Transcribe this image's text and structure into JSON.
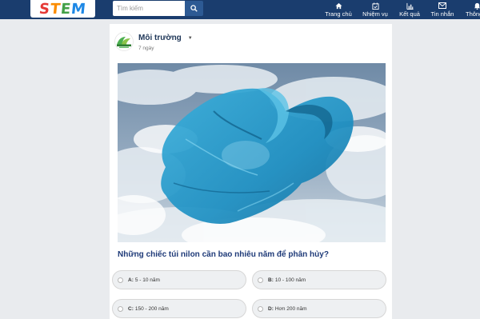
{
  "header": {
    "logo_text": "STEM",
    "search": {
      "placeholder": "Tìm kiếm"
    },
    "nav": [
      {
        "label": "Trang chủ",
        "icon": "home-icon"
      },
      {
        "label": "Nhiệm vụ",
        "icon": "calendar-check-icon"
      },
      {
        "label": "Kết quả",
        "icon": "bar-chart-icon"
      },
      {
        "label": "Tin nhắn",
        "icon": "envelope-icon"
      },
      {
        "label": "Thông",
        "icon": "bell-icon"
      }
    ]
  },
  "post": {
    "author": "Môi trường",
    "time": "7 ngày",
    "question": "Những chiếc túi nilon cần bao nhiêu năm để phân hủy?",
    "options": [
      {
        "key": "A:",
        "text": "5 - 10 năm"
      },
      {
        "key": "B:",
        "text": "10 - 100 năm"
      },
      {
        "key": "C:",
        "text": "150 - 200 năm"
      },
      {
        "key": "D:",
        "text": "Hơn 200 năm"
      }
    ]
  },
  "colors": {
    "header_bg": "#1a3d6e",
    "page_bg": "#e9ebee",
    "question_text": "#1e3a78"
  }
}
